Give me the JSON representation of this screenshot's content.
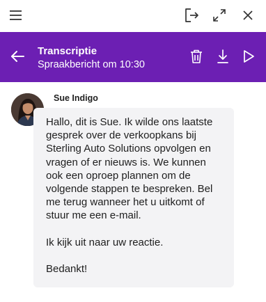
{
  "topbar": {
    "menu_icon": "hamburger-menu-icon",
    "signout_icon": "sign-out-icon",
    "expand_icon": "expand-icon",
    "close_icon": "close-icon"
  },
  "header": {
    "title": "Transcriptie",
    "subtitle": "Spraakbericht om 10:30",
    "accent_color": "#6c1fb3"
  },
  "message": {
    "sender": "Sue Indigo",
    "paragraphs": [
      "Hallo, dit is Sue. Ik wilde ons laatste\ngesprek over de verkoopkans bij\nSterling Auto Solutions opvolgen en\nvragen of er nieuws is. We kunnen\nook een oproep plannen om de\nvolgende stappen te bespreken. Bel\nme terug wanneer het u uitkomt of\nstuur me een e-mail.",
      "Ik kijk uit naar uw reactie.",
      "Bedankt!"
    ]
  }
}
